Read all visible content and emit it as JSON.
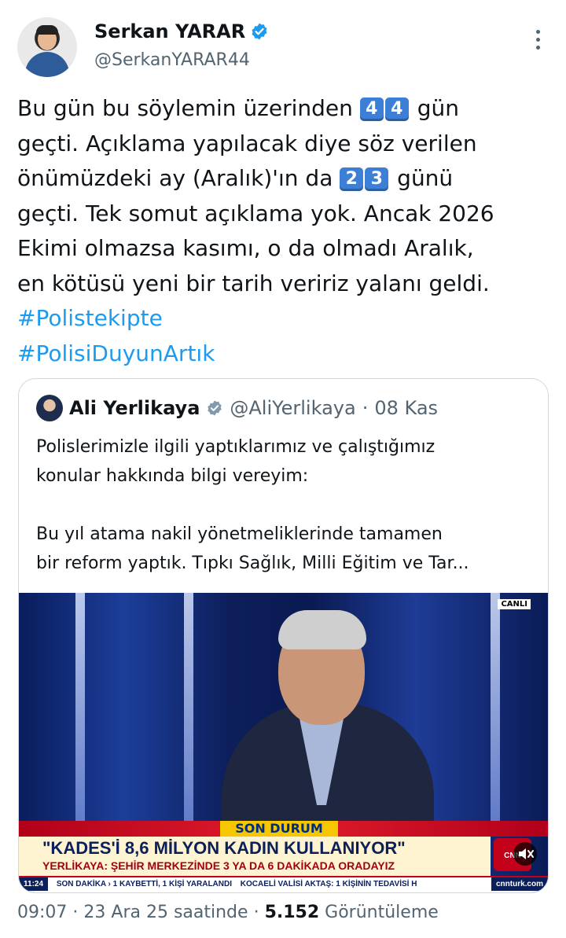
{
  "author": {
    "name": "Serkan YARAR",
    "handle": "@SerkanYARAR44",
    "avatar_icon": "avatar-photo",
    "verified_icon": "verified-badge-icon"
  },
  "tweet": {
    "line1_pre": "Bu gün bu söylemin üzerinden ",
    "line1_key1": "4",
    "line1_key2": "4",
    "line1_post": " gün",
    "line2": "geçti. Açıklama yapılacak diye söz verilen",
    "line3_pre": "önümüzdeki ay (Aralık)'ın da ",
    "line3_key1": "2",
    "line3_key2": "3",
    "line3_post": " günü",
    "line4": "geçti. Tek somut açıklama yok. Ancak 2026",
    "line5": "Ekimi olmazsa kasımı, o da olmadı Aralık,",
    "line6": "en kötüsü yeni bir tarih veririz yalanı geldi.",
    "hashtag1": "#Polistekipte",
    "hashtag2": "#PolisiDuyunArtık"
  },
  "quote": {
    "name": "Ali Yerlikaya",
    "handle": "@AliYerlikaya",
    "separator": "·",
    "date": "08 Kas",
    "line1": "Polislerimizle ilgili yaptıklarımız ve çalıştığımız",
    "line2": "konular hakkında bilgi vereyim:",
    "line3": "Bu yıl atama nakil yönetmeliklerinde tamamen",
    "line4": "bir reform yaptık. Tıpkı Sağlık, Milli Eğitim ve Tar..."
  },
  "media": {
    "live_badge": "CANLI",
    "breaking_label": "SON DURUM",
    "headline": "\"KADES'İ 8,6 MİLYON KADIN KULLANIYOR\"",
    "subheadline": "YERLİKAYA: ŞEHİR MERKEZİNDE 3 YA DA 6 DAKİKADA ORADAYIZ",
    "logo": "CNN TÜRK",
    "ticker_time": "11:24",
    "ticker_1": "SON DAKİKA › 1 KAYBETTİ, 1 KİŞİ YARALANDI",
    "ticker_2": "KOCAELİ VALİSİ AKTAŞ: 1 KİŞİNİN TEDAVİSİ H",
    "ticker_site": "cnnturk.com",
    "mute_icon": "speaker-muted-icon"
  },
  "footer": {
    "time": "09:07",
    "separator": "·",
    "date": "23 Ara 25 saatinde",
    "views": "5.152",
    "views_label": "Görüntüleme"
  }
}
